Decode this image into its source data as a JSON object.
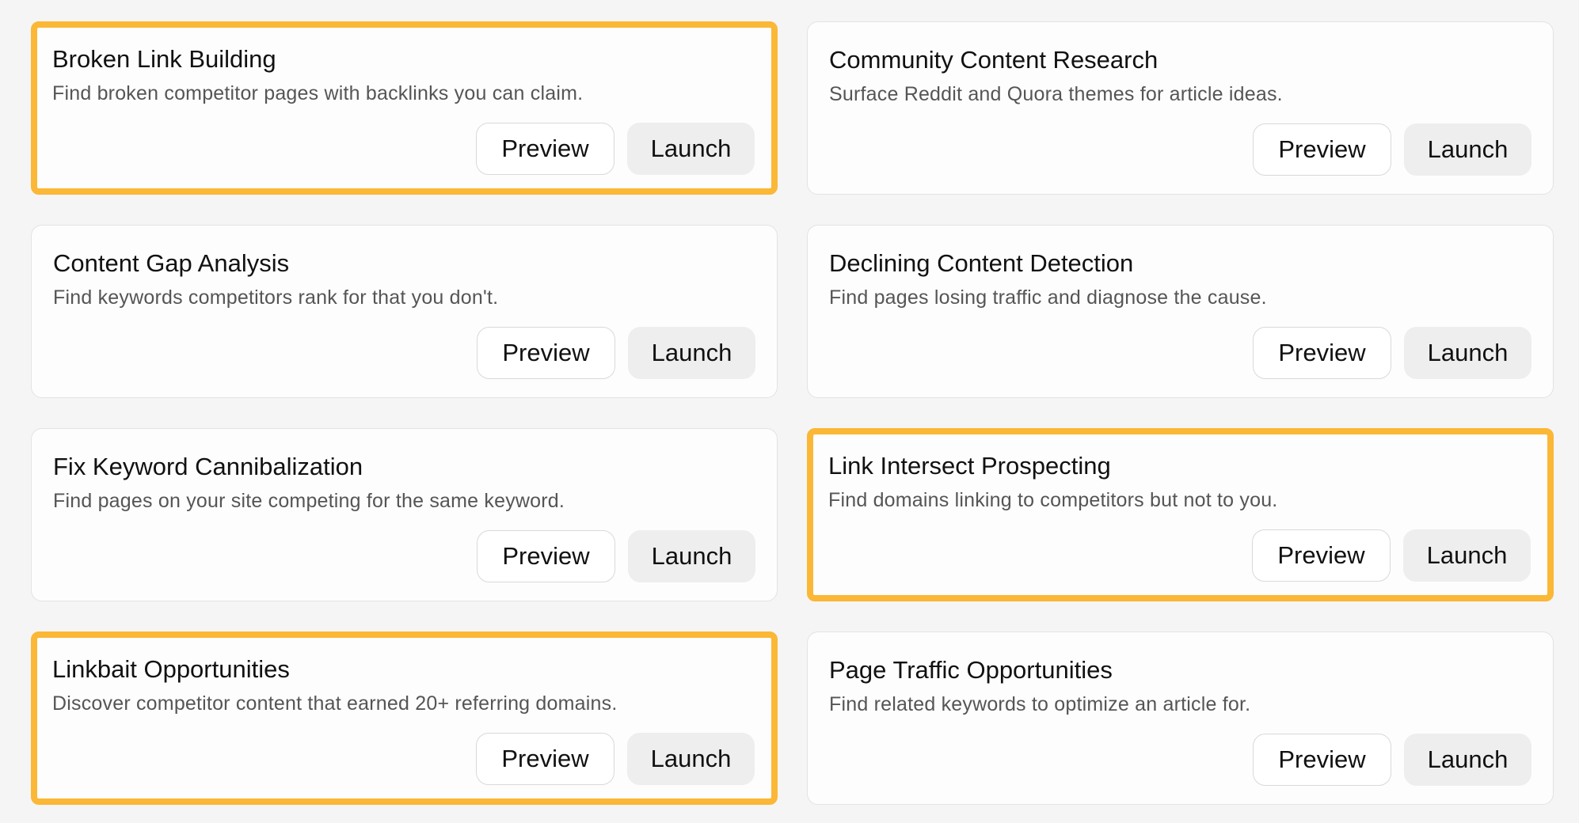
{
  "cards": [
    {
      "title": "Broken Link Building",
      "description": "Find broken competitor pages with backlinks you can claim.",
      "preview_label": "Preview",
      "launch_label": "Launch",
      "highlighted": true
    },
    {
      "title": "Community Content Research",
      "description": "Surface Reddit and Quora themes for article ideas.",
      "preview_label": "Preview",
      "launch_label": "Launch",
      "highlighted": false
    },
    {
      "title": "Content Gap Analysis",
      "description": "Find keywords competitors rank for that you don't.",
      "preview_label": "Preview",
      "launch_label": "Launch",
      "highlighted": false
    },
    {
      "title": "Declining Content Detection",
      "description": "Find pages losing traffic and diagnose the cause.",
      "preview_label": "Preview",
      "launch_label": "Launch",
      "highlighted": false
    },
    {
      "title": "Fix Keyword Cannibalization",
      "description": "Find pages on your site competing for the same keyword.",
      "preview_label": "Preview",
      "launch_label": "Launch",
      "highlighted": false
    },
    {
      "title": "Link Intersect Prospecting",
      "description": "Find domains linking to competitors but not to you.",
      "preview_label": "Preview",
      "launch_label": "Launch",
      "highlighted": true
    },
    {
      "title": "Linkbait Opportunities",
      "description": "Discover competitor content that earned 20+ referring domains.",
      "preview_label": "Preview",
      "launch_label": "Launch",
      "highlighted": true
    },
    {
      "title": "Page Traffic Opportunities",
      "description": "Find related keywords to optimize an article for.",
      "preview_label": "Preview",
      "launch_label": "Launch",
      "highlighted": false
    }
  ],
  "colors": {
    "highlight": "#fbb736",
    "background": "#f5f5f5",
    "card": "#fdfdfd",
    "launch_button": "#eeeeee"
  }
}
